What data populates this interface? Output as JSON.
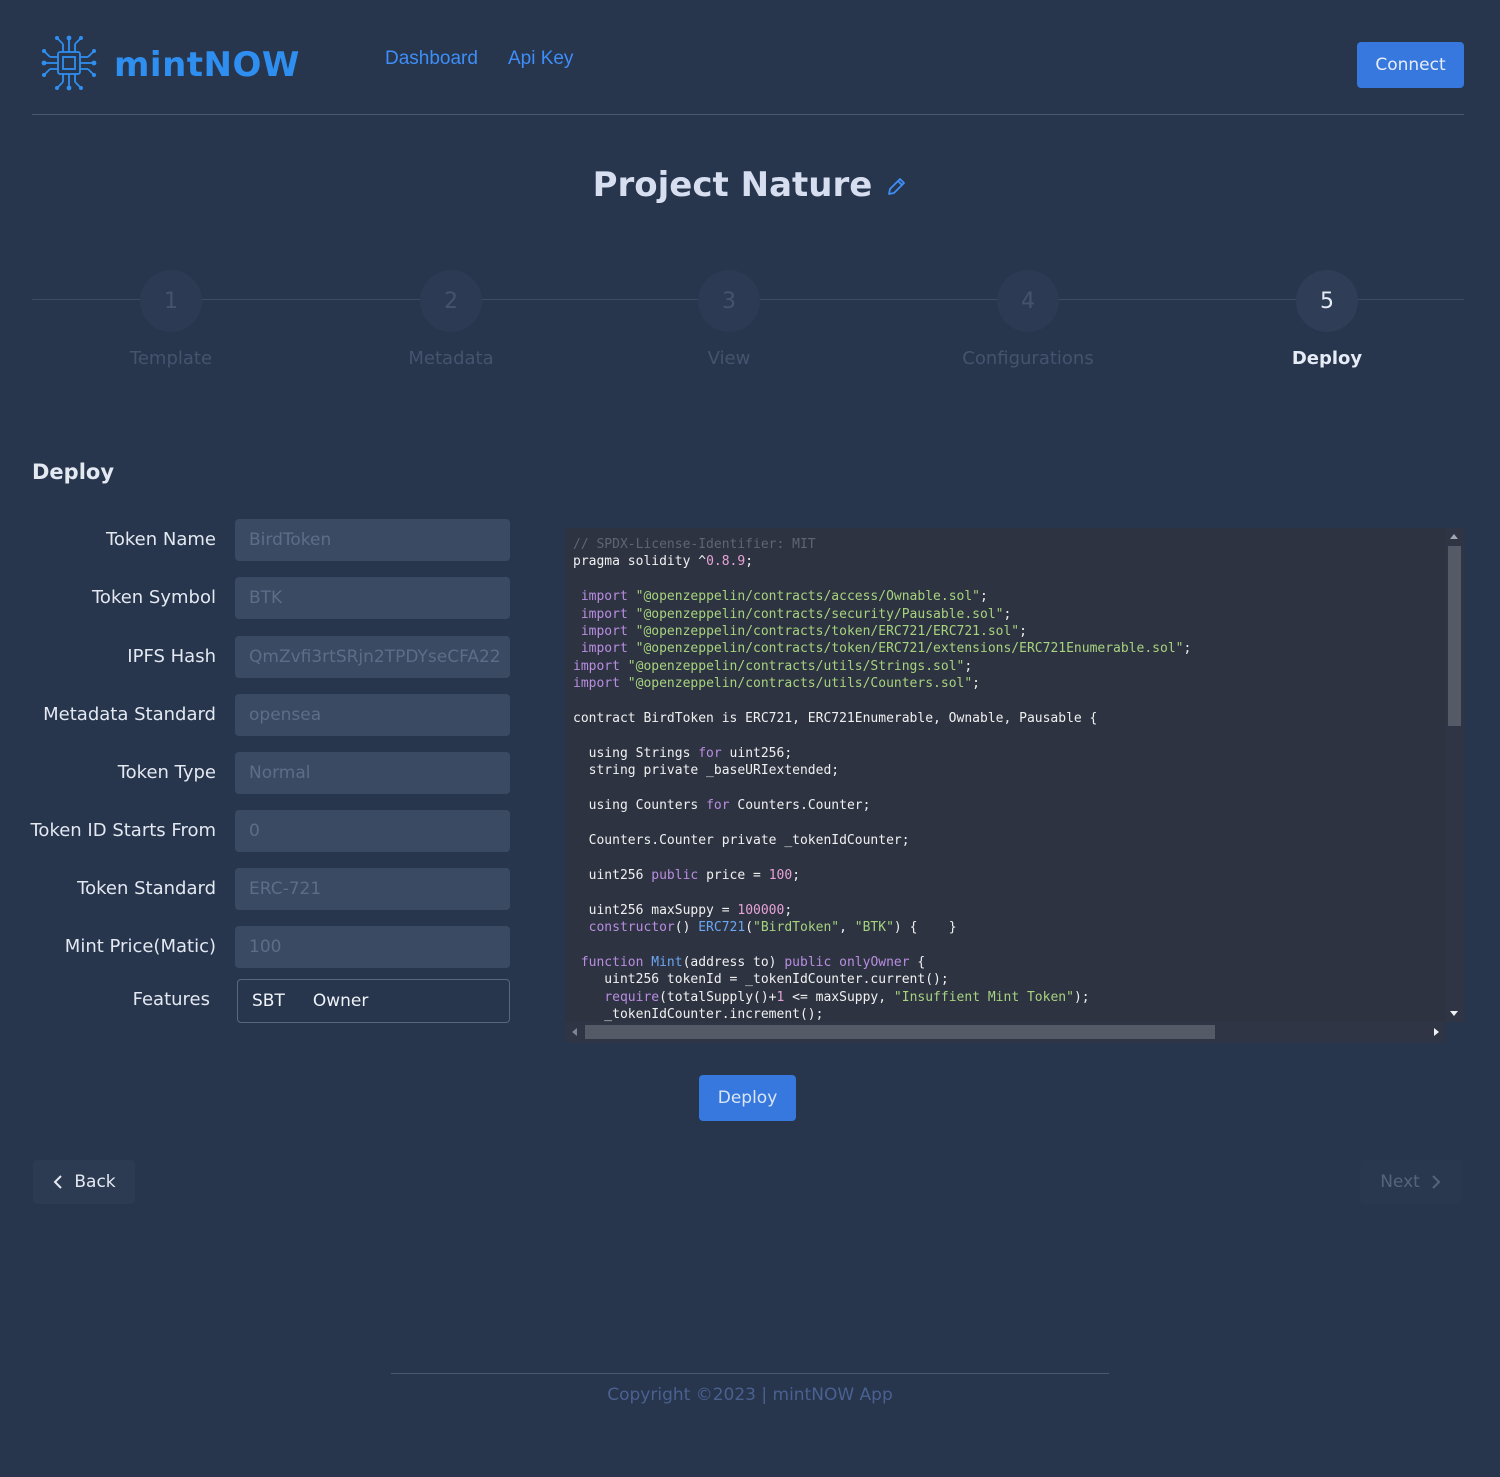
{
  "header": {
    "brand": "mintNOW",
    "logo_icon": "circuit-chip-icon",
    "nav": [
      "Dashboard",
      "Api Key"
    ],
    "connect_label": "Connect"
  },
  "project": {
    "title": "Project Nature",
    "edit_icon": "pencil-icon"
  },
  "stepper": {
    "steps": [
      {
        "number": "1",
        "label": "Template"
      },
      {
        "number": "2",
        "label": "Metadata"
      },
      {
        "number": "3",
        "label": "View"
      },
      {
        "number": "4",
        "label": "Configurations"
      },
      {
        "number": "5",
        "label": "Deploy"
      }
    ],
    "active_step": 5
  },
  "form": {
    "section_title": "Deploy",
    "fields": [
      {
        "label": "Token Name",
        "value": "BirdToken"
      },
      {
        "label": "Token Symbol",
        "value": "BTK"
      },
      {
        "label": "IPFS Hash",
        "value": "QmZvfi3rtSRjn2TPDYseCFA22"
      },
      {
        "label": "Metadata Standard",
        "value": "opensea"
      },
      {
        "label": "Token Type",
        "value": "Normal"
      },
      {
        "label": "Token ID Starts From",
        "value": "0"
      },
      {
        "label": "Token Standard",
        "value": "ERC-721"
      },
      {
        "label": "Mint Price(Matic)",
        "value": "100"
      }
    ],
    "features": {
      "label": "Features",
      "items": [
        "SBT",
        "Owner"
      ]
    }
  },
  "code": {
    "lines": [
      "// SPDX-License-Identifier: MIT",
      "pragma solidity ^0.8.9;",
      "",
      " import \"@openzeppelin/contracts/access/Ownable.sol\";",
      " import \"@openzeppelin/contracts/security/Pausable.sol\";",
      " import \"@openzeppelin/contracts/token/ERC721/ERC721.sol\";",
      " import \"@openzeppelin/contracts/token/ERC721/extensions/ERC721Enumerable.sol\";",
      "import \"@openzeppelin/contracts/utils/Strings.sol\";",
      "import \"@openzeppelin/contracts/utils/Counters.sol\";",
      "",
      "contract BirdToken is ERC721, ERC721Enumerable, Ownable, Pausable {",
      "",
      "  using Strings for uint256;",
      "  string private _baseURIextended;",
      "",
      "  using Counters for Counters.Counter;",
      "",
      "  Counters.Counter private _tokenIdCounter;",
      "",
      "  uint256 public price = 100;",
      "",
      "  uint256 maxSuppy = 100000;",
      "  constructor() ERC721(\"BirdToken\", \"BTK\") {    }",
      "",
      " function Mint(address to) public onlyOwner {",
      "    uint256 tokenId = _tokenIdCounter.current();",
      "    require(totalSupply()+1 <= maxSuppy, \"Insuffient Mint Token\");",
      "    _tokenIdCounter.increment();"
    ]
  },
  "actions": {
    "deploy_label": "Deploy",
    "back_label": "Back",
    "next_label": "Next"
  },
  "footer": {
    "copyright": "Copyright ©2023 | mintNOW App"
  },
  "colors": {
    "background": "#27354d",
    "accent": "#3678de",
    "brand": "#2f8ff0"
  }
}
